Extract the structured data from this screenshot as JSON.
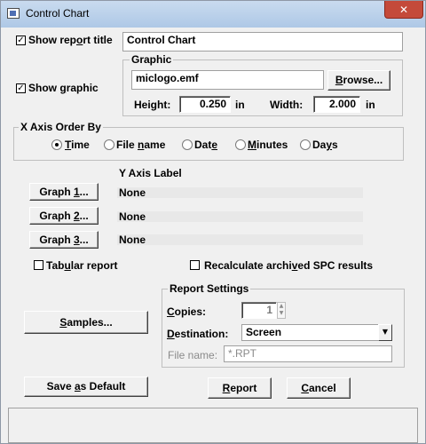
{
  "window": {
    "title": "Control Chart",
    "icon": "app-window-icon",
    "close_glyph": "✕"
  },
  "report_title": {
    "label": "Show report title",
    "checked": true,
    "value": "Control Chart"
  },
  "graphic": {
    "show_label": "Show graphic",
    "checked": true,
    "group_label": "Graphic",
    "file": "miclogo.emf",
    "browse_label": "Browse...",
    "height_label": "Height:",
    "height_value": "0.250",
    "height_unit": "in",
    "width_label": "Width:",
    "width_value": "2.000",
    "width_unit": "in"
  },
  "x_axis": {
    "group_label": "X Axis Order By",
    "options": [
      "Time",
      "File name",
      "Date",
      "Minutes",
      "Days"
    ],
    "selected": "Time"
  },
  "y_axis": {
    "header": "Y Axis Label",
    "graphs": [
      {
        "button": "Graph 1...",
        "label": "None"
      },
      {
        "button": "Graph 2...",
        "label": "None"
      },
      {
        "button": "Graph 3...",
        "label": "None"
      }
    ]
  },
  "tabular_report": {
    "label": "Tabular report",
    "checked": false
  },
  "recalculate": {
    "label": "Recalculate archived SPC results",
    "checked": false
  },
  "samples_button": "Samples...",
  "report_settings": {
    "group_label": "Report Settings",
    "copies_label": "Copies:",
    "copies_value": "1",
    "destination_label": "Destination:",
    "destination_value": "Screen",
    "filename_label": "File name:",
    "filename_value": "*.RPT"
  },
  "buttons": {
    "save_default": "Save as Default",
    "report": "Report",
    "cancel": "Cancel"
  },
  "colors": {
    "title_bar": "#b9d1ea",
    "close": "#c44a3a",
    "dialog_bg": "#f0f0f0"
  }
}
